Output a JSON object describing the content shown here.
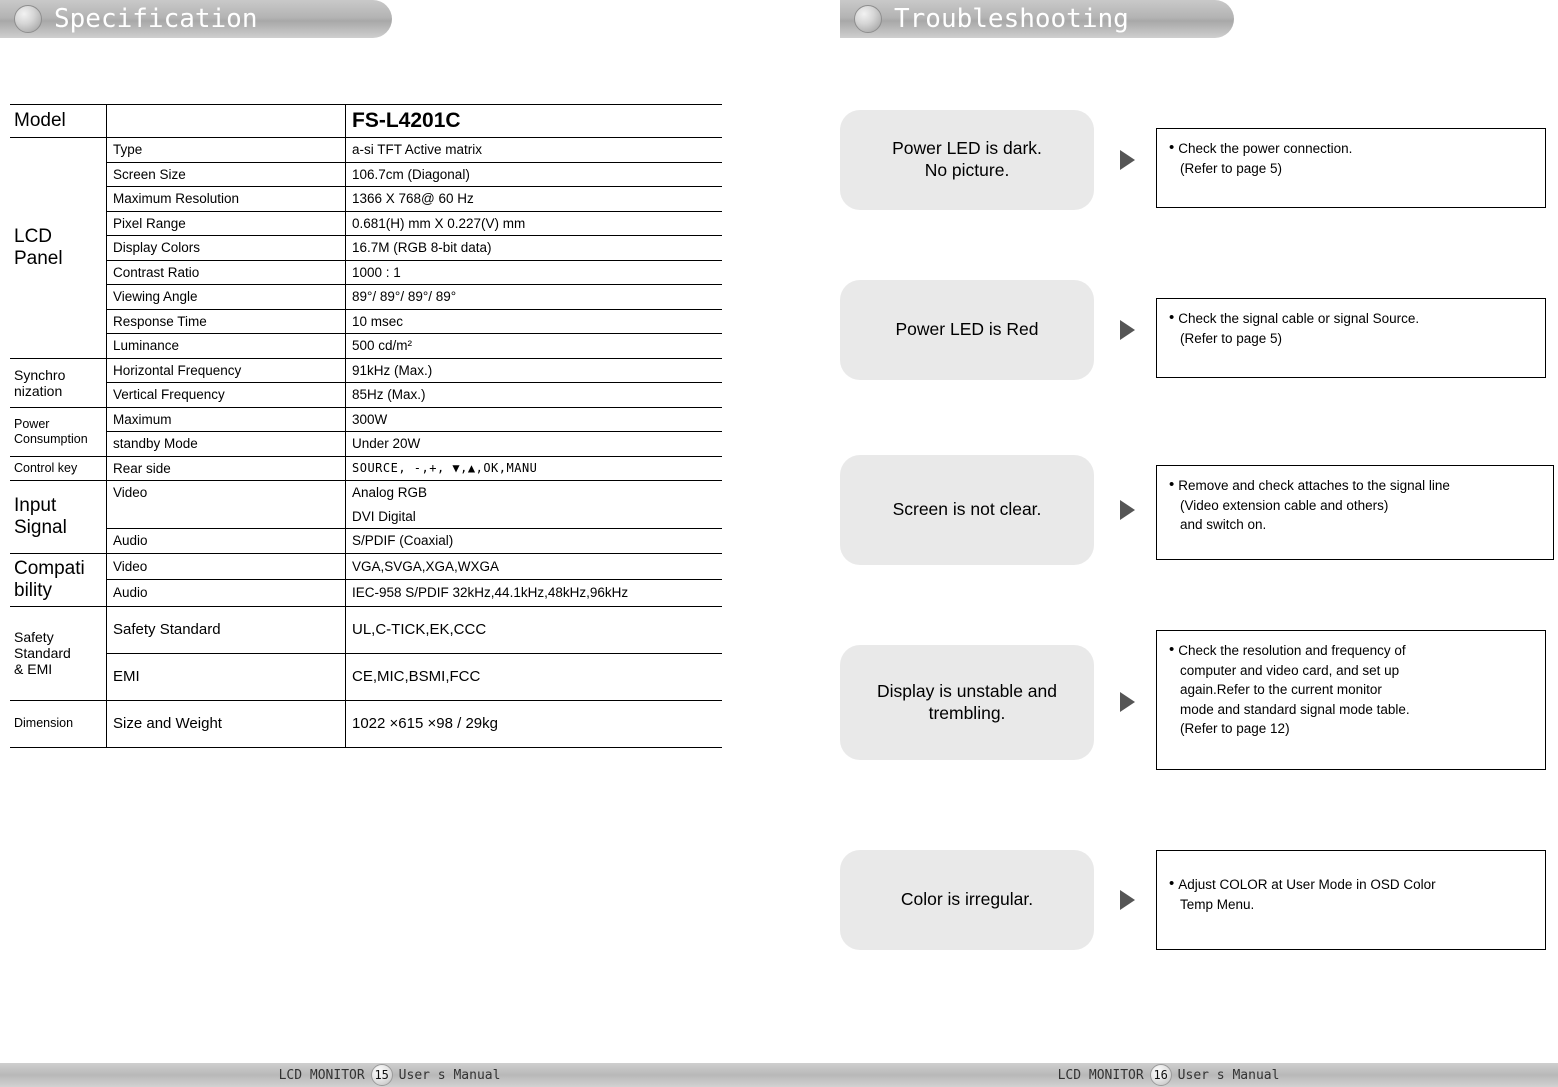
{
  "tabs": {
    "specification": "Specification",
    "troubleshooting": "Troubleshooting"
  },
  "footers": {
    "left": {
      "prefix": "LCD  MONITOR",
      "page": "15",
      "suffix": "User s Manual"
    },
    "right": {
      "prefix": "LCD  MONITOR",
      "page": "16",
      "suffix": "User s Manual"
    }
  },
  "spec": {
    "model_label": "Model",
    "model_value": "FS-L4201C",
    "groups": [
      {
        "name": "LCD\nPanel",
        "rows": [
          {
            "item": "Type",
            "value": "a-si TFT Active matrix"
          },
          {
            "item": "Screen Size",
            "value": "106.7cm (Diagonal)"
          },
          {
            "item": "Maximum Resolution",
            "value": "1366 X 768@ 60 Hz"
          },
          {
            "item": "Pixel Range",
            "value": "0.681(H) mm X 0.227(V) mm"
          },
          {
            "item": "Display Colors",
            "value": "16.7M (RGB 8-bit data)"
          },
          {
            "item": "Contrast Ratio",
            "value": "1000 : 1"
          },
          {
            "item": "Viewing Angle",
            "value": "89°/ 89°/ 89°/ 89°"
          },
          {
            "item": "Response Time",
            "value": "10 msec"
          },
          {
            "item": "Luminance",
            "value": "500 cd/m²"
          }
        ]
      },
      {
        "name": "Synchro\nnization",
        "rows": [
          {
            "item": "Horizontal Frequency",
            "value": "91kHz (Max.)"
          },
          {
            "item": "Vertical Frequency",
            "value": "85Hz (Max.)"
          }
        ]
      },
      {
        "name": "Power\nConsumption",
        "rows": [
          {
            "item": "Maximum",
            "value": "300W"
          },
          {
            "item": "standby Mode",
            "value": "Under 20W"
          }
        ]
      },
      {
        "name": "Control key",
        "rows": [
          {
            "item": "Rear side",
            "value": "SOURCE, -,+,  ▼,▲,OK,MANU"
          }
        ]
      },
      {
        "name": "Input\nSignal",
        "rows": [
          {
            "item": "Video",
            "value": "Analog RGB"
          },
          {
            "item": "",
            "value": "DVI Digital"
          },
          {
            "item": "Audio",
            "value": "S/PDIF (Coaxial)"
          }
        ]
      },
      {
        "name": "Compati\nbility",
        "rows": [
          {
            "item": "Video",
            "value": "VGA,SVGA,XGA,WXGA"
          },
          {
            "item": "Audio",
            "value": "IEC-958 S/PDIF 32kHz,44.1kHz,48kHz,96kHz"
          }
        ]
      },
      {
        "name": "Safety\nStandard\n& EMI",
        "rows": [
          {
            "item": "Safety Standard",
            "value": "UL,C-TICK,EK,CCC"
          },
          {
            "item": "EMI",
            "value": "CE,MIC,BSMI,FCC"
          }
        ]
      },
      {
        "name": "Dimension",
        "rows": [
          {
            "item": "Size and Weight",
            "value": "1022 ×615 ×98 / 29kg"
          }
        ]
      }
    ]
  },
  "troubleshooting": {
    "items": [
      {
        "symptom": "Power LED is dark.\nNo picture.",
        "solution_lines": [
          "Check the power connection.",
          "(Refer to page 5)"
        ]
      },
      {
        "symptom": "Power LED is Red",
        "solution_lines": [
          "Check the signal cable or signal Source.",
          "(Refer to page 5)"
        ]
      },
      {
        "symptom": "Screen is not clear.",
        "solution_lines": [
          "Remove and check attaches to the signal line",
          "(Video extension cable and others)",
          "and switch on."
        ]
      },
      {
        "symptom": "Display is unstable and\ntrembling.",
        "solution_lines": [
          "Check the resolution and frequency of",
          "computer and video card, and set up",
          "again.Refer to the current monitor",
          "mode and standard signal mode table.",
          "(Refer to page 12)"
        ]
      },
      {
        "symptom": "Color is irregular.",
        "solution_lines": [
          "Adjust COLOR at User Mode in OSD Color",
          "Temp Menu."
        ]
      }
    ]
  }
}
